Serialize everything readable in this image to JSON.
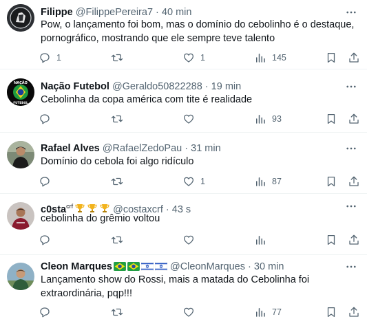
{
  "tweets": [
    {
      "name": "Filippe",
      "handle": "@FilippePereira7",
      "sep": "·",
      "time": "40 min",
      "text": "Pow, o lançamento foi bom, mas o domínio do cebolinho é o destaque, pornográfico, mostrando que ele sempre teve talento",
      "replies": "1",
      "retweets": "",
      "likes": "1",
      "views": "145"
    },
    {
      "name": "Nação Futebol",
      "handle": "@Geraldo50822288",
      "sep": "·",
      "time": "19 min",
      "text": "Cebolinha da copa américa com tite é realidade",
      "replies": "",
      "retweets": "",
      "likes": "",
      "views": "93"
    },
    {
      "name": "Rafael Alves",
      "handle": "@RafaelZedoPau",
      "sep": "·",
      "time": "31 min",
      "text": "Domínio do cebola foi algo ridículo",
      "replies": "",
      "retweets": "",
      "likes": "1",
      "views": "87"
    },
    {
      "name": "c0sta",
      "name_sup": "crf",
      "handle": "@costaxcrf",
      "sep": "·",
      "time": "43 s",
      "text": "cebolinha do grêmio voltou",
      "replies": "",
      "retweets": "",
      "likes": "",
      "views": ""
    },
    {
      "name": "Cleon Marques",
      "handle": "@CleonMarques",
      "sep": "·",
      "time": "30 min",
      "text": "Lançamento show do Rossi, mais a matada do Cebolinha foi extraordinária, pqp!!!",
      "replies": "",
      "retweets": "",
      "likes": "",
      "views": "77"
    }
  ],
  "avatar_labels": {
    "nacao_top": "NAÇÃO",
    "nacao_bottom": "FUTEBOL"
  },
  "icons": [
    "more-icon",
    "reply-icon",
    "retweet-icon",
    "like-icon",
    "views-icon",
    "bookmark-icon",
    "share-icon",
    "trophy-icon",
    "brazil-flag-icon",
    "israel-flag-icon"
  ],
  "colors": {
    "text": "#0f1419",
    "secondary": "#536471",
    "divider": "#eff3f4",
    "background": "#ffffff"
  }
}
